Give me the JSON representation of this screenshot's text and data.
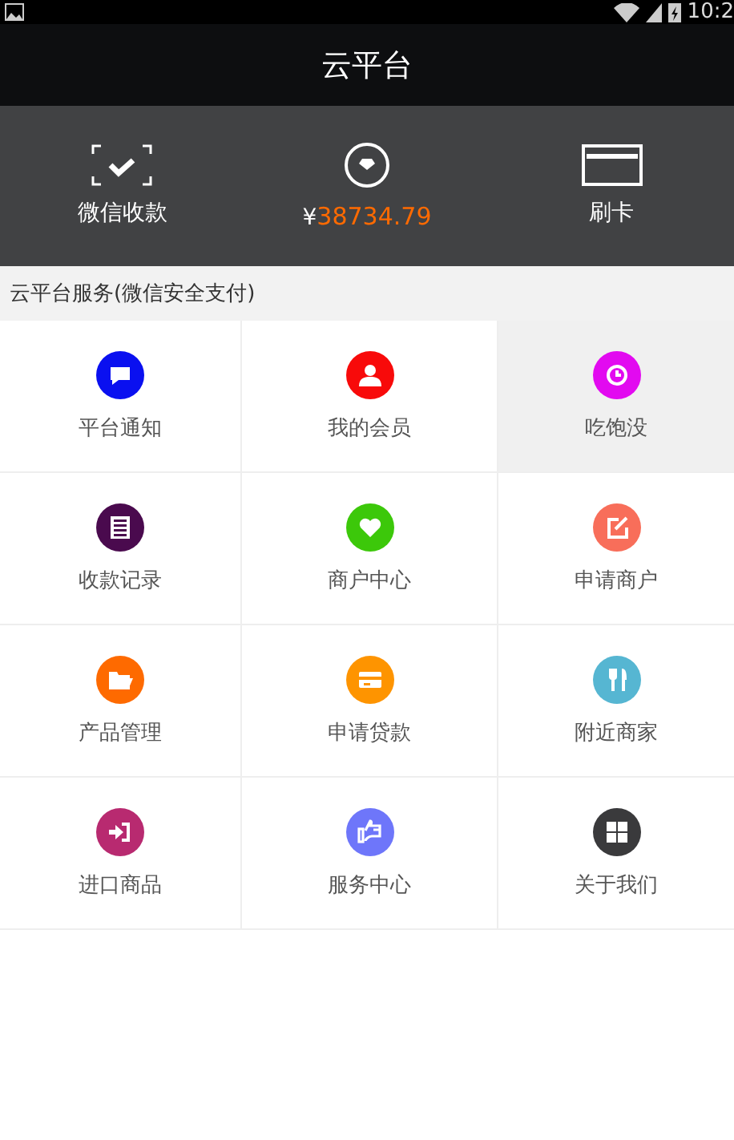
{
  "status_bar": {
    "time": "10:2"
  },
  "window": {
    "title": "云平台"
  },
  "header_actions": [
    {
      "label": "微信收款",
      "kind": "scan"
    },
    {
      "kind": "balance",
      "currency": "¥",
      "amount": "38734.79"
    },
    {
      "label": "刷卡",
      "kind": "card"
    }
  ],
  "section": {
    "title": "云平台服务(微信安全支付)"
  },
  "services": [
    {
      "label": "平台通知",
      "color": "#0a10f0",
      "selected": false
    },
    {
      "label": "我的会员",
      "color": "#f80a0a",
      "selected": false
    },
    {
      "label": "吃饱没",
      "color": "#e20af0",
      "selected": true
    },
    {
      "label": "收款记录",
      "color": "#4a0a4e",
      "selected": false
    },
    {
      "label": "商户中心",
      "color": "#3cc80a",
      "selected": false
    },
    {
      "label": "申请商户",
      "color": "#f86e5a",
      "selected": false
    },
    {
      "label": "产品管理",
      "color": "#fe6a00",
      "selected": false
    },
    {
      "label": "申请贷款",
      "color": "#fe9400",
      "selected": false
    },
    {
      "label": "附近商家",
      "color": "#56b6d2",
      "selected": false
    },
    {
      "label": "进口商品",
      "color": "#b82a70",
      "selected": false
    },
    {
      "label": "服务中心",
      "color": "#6e76fa",
      "selected": false
    },
    {
      "label": "关于我们",
      "color": "#3a3a3c",
      "selected": false
    }
  ]
}
